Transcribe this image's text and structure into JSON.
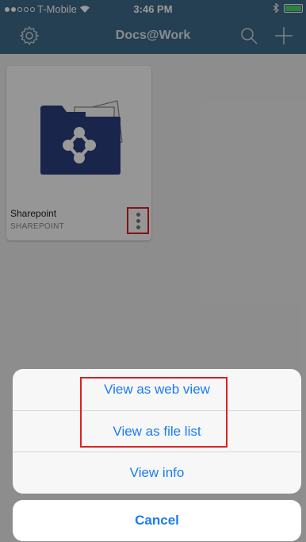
{
  "status_bar": {
    "carrier": "T-Mobile",
    "time": "3:46 PM"
  },
  "nav": {
    "title": "Docs@Work",
    "left_icon": "gear-icon",
    "right_icons": [
      "search-icon",
      "plus-icon"
    ]
  },
  "cards": [
    {
      "name": "Sharepoint",
      "type": "SHAREPOINT",
      "icon": "sharepoint-folder-icon"
    }
  ],
  "action_sheet": {
    "items": [
      {
        "label": "View as web view"
      },
      {
        "label": "View as file list"
      },
      {
        "label": "View info"
      }
    ],
    "cancel_label": "Cancel"
  },
  "colors": {
    "nav_bar": "#3e6a8a",
    "folder": "#2a3f7e",
    "action_text": "#1a7cf5",
    "highlight": "#e02020"
  }
}
